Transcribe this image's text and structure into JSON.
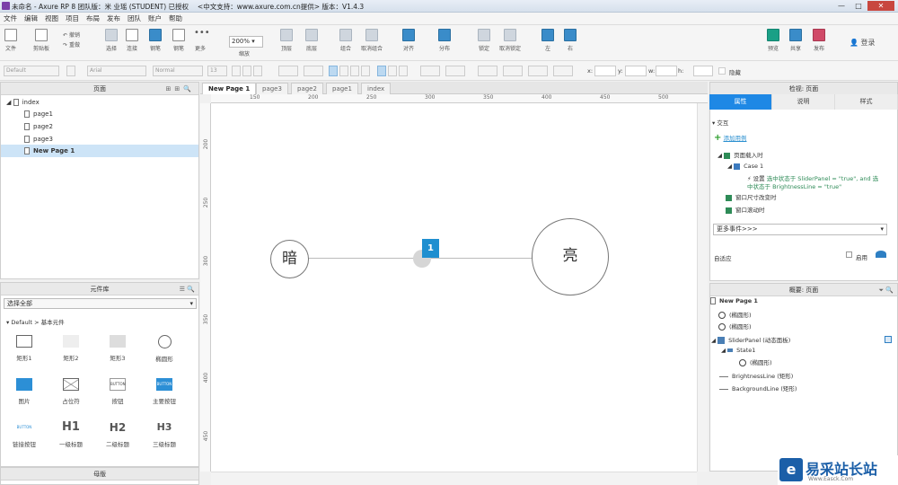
{
  "window": {
    "title": "未命名 - Axure RP 8 团队版：米 业瑶 (STUDENT) 已授权　 <中文支持：www.axure.com.cn提供> 版本：V1.4.3"
  },
  "menu": [
    "文件",
    "编辑",
    "视图",
    "项目",
    "布局",
    "发布",
    "团队",
    "账户",
    "帮助"
  ],
  "toolbar": {
    "file": "文件",
    "clipboard": "剪贴板",
    "undo": "撤销",
    "redo": "重做",
    "select": "选择",
    "connect": "连接",
    "pen": "钢笔",
    "more": "更多",
    "zoom_value": "200%",
    "zoom_label": "缩放",
    "top": "顶层",
    "bottom": "底层",
    "group": "组合",
    "ungroup": "取消组合",
    "align": "对齐",
    "distribute": "分布",
    "lock": "锁定",
    "unlock": "取消锁定",
    "left": "左",
    "right": "右",
    "preview": "预览",
    "share": "共享",
    "publish": "发布",
    "login": "登录"
  },
  "format": {
    "style": "Default",
    "font": "Arial",
    "weight": "Normal",
    "size": "13",
    "x_label": "x:",
    "y_label": "y:",
    "w_label": "w:",
    "h_label": "h:",
    "hidden_label": "隐藏"
  },
  "pages_panel": {
    "title": "页面",
    "items": [
      "index",
      "page1",
      "page2",
      "page3",
      "New Page 1"
    ],
    "selected": "New Page 1"
  },
  "library_panel": {
    "title": "元件库",
    "filter": "选择全部",
    "group": "Default > 基本元件",
    "items": [
      "矩形1",
      "矩形2",
      "矩形3",
      "椭圆形",
      "图片",
      "占位符",
      "按钮",
      "主要按钮",
      "链接按钮",
      "一级标题",
      "二级标题",
      "三级标题"
    ],
    "btn_caption": "BUTTON",
    "h1": "H1",
    "h2": "H2",
    "h3": "H3"
  },
  "masters_panel": {
    "title": "母版"
  },
  "canvas": {
    "tabs": [
      "New Page 1",
      "page3",
      "page2",
      "page1",
      "index"
    ],
    "active_tab": "New Page 1",
    "hruler": [
      "150",
      "200",
      "250",
      "300",
      "350",
      "400",
      "450",
      "500"
    ],
    "vruler": [
      "200",
      "250",
      "300",
      "350",
      "400",
      "450"
    ],
    "dark_label": "暗",
    "bright_label": "亮",
    "badge": "1"
  },
  "inspector": {
    "title": "检视: 页面",
    "tabs": [
      "属性",
      "说明",
      "样式"
    ],
    "section": "交互",
    "add_case": "添加用例",
    "events": {
      "page_load": "页面载入时",
      "case": "Case 1",
      "action_prefix": "设置 ",
      "action_green": "选中状态于 SliderPanel = \"true\", and 选中状态于 BrightnessLine = \"true\"",
      "resize": "窗口尺寸改变时",
      "scroll": "窗口滚动时"
    },
    "more_events": "更多事件>>>",
    "adaptive": "自适应",
    "enable": "启用"
  },
  "outline": {
    "title": "概要: 页面",
    "page": "New Page 1",
    "ellipse1": "(椭圆形)",
    "ellipse2": "(椭圆形)",
    "panel": "SliderPanel (动态面板)",
    "state": "State1",
    "ellipse3": "(椭圆形)",
    "line1": "BrightnessLine (矩形)",
    "line2": "BackgroundLine (矩形)"
  },
  "watermark": {
    "text": "易采站长站",
    "sub": "Www.Easck.Com"
  },
  "colors": {
    "accent": "#1e88e5",
    "badge": "#1f8fd0",
    "event_green": "#2e8b57"
  }
}
